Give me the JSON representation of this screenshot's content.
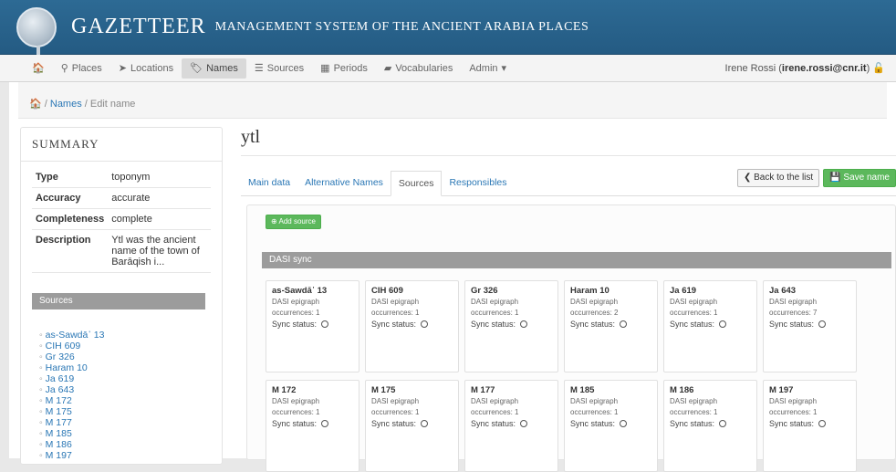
{
  "header": {
    "title_main": "GAZETTEER",
    "title_sub": "MANAGEMENT SYSTEM OF THE ANCIENT ARABIA PLACES"
  },
  "nav": {
    "items": [
      {
        "label": "Places",
        "icon": "map-marker-icon"
      },
      {
        "label": "Locations",
        "icon": "location-arrow-icon"
      },
      {
        "label": "Names",
        "icon": "tag-icon"
      },
      {
        "label": "Sources",
        "icon": "list-icon"
      },
      {
        "label": "Periods",
        "icon": "calendar-icon"
      },
      {
        "label": "Vocabularies",
        "icon": "book-icon"
      },
      {
        "label": "Admin",
        "icon": "caret-down-icon"
      }
    ],
    "user_name": "Irene Rossi",
    "user_email": "irene.rossi@cnr.it"
  },
  "breadcrumb": {
    "names": "Names",
    "current": "Edit name"
  },
  "summary": {
    "title": "SUMMARY",
    "rows": [
      {
        "key": "Type",
        "value": "toponym"
      },
      {
        "key": "Accuracy",
        "value": "accurate"
      },
      {
        "key": "Completeness",
        "value": "complete"
      },
      {
        "key": "Description",
        "value": "Ytl was the ancient name of the town of Barāqish i..."
      }
    ],
    "sources_title": "Sources",
    "sources": [
      "as-Sawdā᾽ 13",
      "CIH 609",
      "Gr 326",
      "Haram 10",
      "Ja 619",
      "Ja 643",
      "M 172",
      "M 175",
      "M 177",
      "M 185",
      "M 186",
      "M 197"
    ]
  },
  "main": {
    "title": "ytl",
    "tabs": [
      "Main data",
      "Alternative Names",
      "Sources",
      "Responsibles"
    ],
    "back_label": "Back to the list",
    "save_label": "Save name",
    "add_source_label": "Add source",
    "sync_title": "DASI sync",
    "sync_label": "Sync status:",
    "cards": [
      {
        "name": "as-Sawdā᾽ 13",
        "type": "DASI epigraph",
        "occ": "occurrences: 1"
      },
      {
        "name": "CIH 609",
        "type": "DASI epigraph",
        "occ": "occurrences: 1"
      },
      {
        "name": "Gr 326",
        "type": "DASI epigraph",
        "occ": "occurrences: 1"
      },
      {
        "name": "Haram 10",
        "type": "DASI epigraph",
        "occ": "occurrences: 2"
      },
      {
        "name": "Ja 619",
        "type": "DASI epigraph",
        "occ": "occurrences: 1"
      },
      {
        "name": "Ja 643",
        "type": "DASI epigraph",
        "occ": "occurrences: 7"
      },
      {
        "name": "M 172",
        "type": "DASI epigraph",
        "occ": "occurrences: 1"
      },
      {
        "name": "M 175",
        "type": "DASI epigraph",
        "occ": "occurrences: 1"
      },
      {
        "name": "M 177",
        "type": "DASI epigraph",
        "occ": "occurrences: 1"
      },
      {
        "name": "M 185",
        "type": "DASI epigraph",
        "occ": "occurrences: 1"
      },
      {
        "name": "M 186",
        "type": "DASI epigraph",
        "occ": "occurrences: 1"
      },
      {
        "name": "M 197",
        "type": "DASI epigraph",
        "occ": "occurrences: 1"
      }
    ]
  },
  "colors": {
    "banner": "#2d6a94",
    "link": "#2a77b5",
    "save_green": "#5cb85c",
    "section_gray": "#9c9c9c"
  }
}
